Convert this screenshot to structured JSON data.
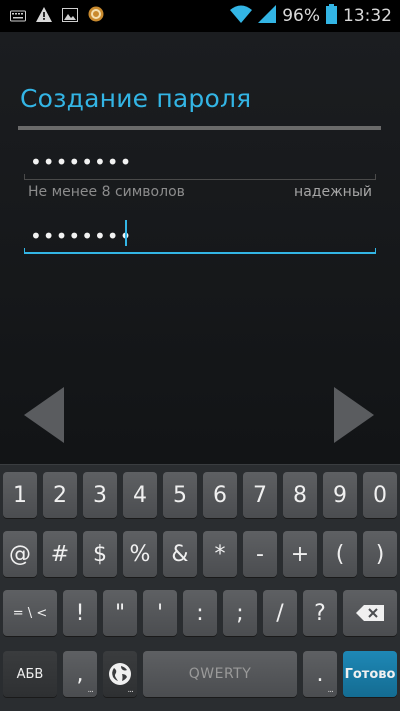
{
  "status_bar": {
    "battery_percent": "96%",
    "time": "13:32",
    "icons": [
      "keyboard-icon",
      "warning-icon",
      "gallery-icon",
      "app-icon",
      "wifi-icon",
      "signal-icon",
      "battery-icon"
    ]
  },
  "screen": {
    "title": "Создание пароля",
    "password_field": {
      "value": "••••••••"
    },
    "hint": "Не менее 8 символов",
    "strength": "надежный",
    "confirm_field": {
      "value": "••••••••"
    }
  },
  "colors": {
    "accent": "#33b5e5",
    "background": "#15171a",
    "keyboard_bg": "#2a2d30",
    "key_bg": "#55575a",
    "go_key": "#1a7ba6"
  },
  "keyboard": {
    "row1": [
      "1",
      "2",
      "3",
      "4",
      "5",
      "6",
      "7",
      "8",
      "9",
      "0"
    ],
    "row2": [
      "@",
      "#",
      "$",
      "%",
      "&",
      "*",
      "-",
      "+",
      "(",
      ")"
    ],
    "row3": [
      "= \\ <",
      "!",
      "\"",
      "'",
      ":",
      ";",
      "/",
      "?"
    ],
    "row4": {
      "abc": "АБВ",
      "comma": ",",
      "space": "QWERTY",
      "period": ".",
      "go": "Готово"
    }
  }
}
